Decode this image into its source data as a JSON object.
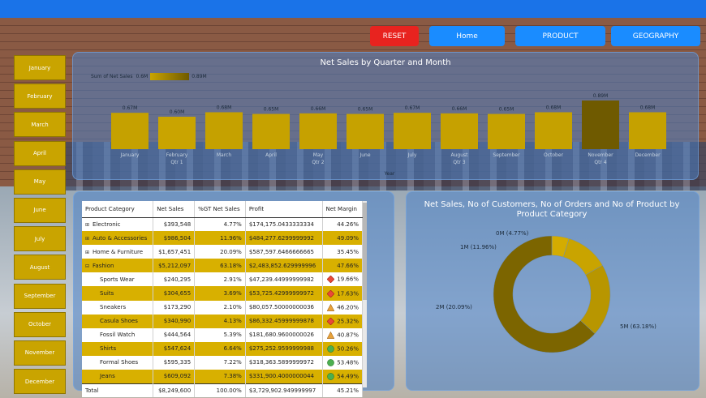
{
  "nav": {
    "reset": "RESET",
    "home": "Home",
    "product": "PRODUCT",
    "geography": "GEOGRAPHY"
  },
  "months": [
    "January",
    "February",
    "March",
    "April",
    "May",
    "June",
    "July",
    "August",
    "September",
    "October",
    "November",
    "December"
  ],
  "bar_chart": {
    "title": "Net Sales by Quarter and Month",
    "legend_label": "Sum of Net Sales",
    "legend_min": "0.6M",
    "legend_max": "0.89M",
    "xaxis_label": "Year",
    "categories": [
      "January",
      "February",
      "March",
      "April",
      "May",
      "June",
      "July",
      "August",
      "September",
      "October",
      "November",
      "December"
    ],
    "value_labels": [
      "0.67M",
      "0.60M",
      "0.68M",
      "0.65M",
      "0.66M",
      "0.65M",
      "0.67M",
      "0.66M",
      "0.65M",
      "0.68M",
      "0.89M",
      "0.68M"
    ],
    "values": [
      0.67,
      0.6,
      0.68,
      0.65,
      0.66,
      0.65,
      0.67,
      0.66,
      0.65,
      0.68,
      0.89,
      0.68
    ],
    "qtr_labels": [
      "Qtr 1",
      "Qtr 2",
      "Qtr 3",
      "Qtr 4"
    ],
    "colors": {
      "low": "#c9a400",
      "high": "#6f5a00"
    }
  },
  "table": {
    "headers": [
      "Product Category",
      "Net Sales",
      "%GT Net Sales",
      "Profit",
      "Net Margin"
    ],
    "rows": [
      {
        "cat": "Electronic",
        "sales": "$393,548",
        "pct": "4.77%",
        "profit": "$174,175.0433333334",
        "margin": "44.26%",
        "level": 0,
        "hl": false,
        "icon": ""
      },
      {
        "cat": "Auto & Accessories",
        "sales": "$986,504",
        "pct": "11.96%",
        "profit": "$484,277.6299999992",
        "margin": "49.09%",
        "level": 0,
        "hl": true,
        "icon": ""
      },
      {
        "cat": "Home & Furniture",
        "sales": "$1,657,451",
        "pct": "20.09%",
        "profit": "$587,597.6466666665",
        "margin": "35.45%",
        "level": 0,
        "hl": false,
        "icon": ""
      },
      {
        "cat": "Fashion",
        "sales": "$5,212,097",
        "pct": "63.18%",
        "profit": "$2,483,852.629999996",
        "margin": "47.66%",
        "level": 0,
        "hl": true,
        "icon": ""
      },
      {
        "cat": "Sports Wear",
        "sales": "$240,295",
        "pct": "2.91%",
        "profit": "$47,239.44999999982",
        "margin": "19.66%",
        "level": 1,
        "hl": false,
        "icon": "diamond"
      },
      {
        "cat": "Suits",
        "sales": "$304,655",
        "pct": "3.69%",
        "profit": "$53,725.42999999972",
        "margin": "17.63%",
        "level": 1,
        "hl": true,
        "icon": "diamond"
      },
      {
        "cat": "Sneakers",
        "sales": "$173,290",
        "pct": "2.10%",
        "profit": "$80,057.50000000036",
        "margin": "46.20%",
        "level": 1,
        "hl": false,
        "icon": "triangle"
      },
      {
        "cat": "Casula Shoes",
        "sales": "$340,990",
        "pct": "4.13%",
        "profit": "$86,332.45999999878",
        "margin": "25.32%",
        "level": 1,
        "hl": true,
        "icon": "diamond"
      },
      {
        "cat": "Fossil Watch",
        "sales": "$444,564",
        "pct": "5.39%",
        "profit": "$181,680.9600000026",
        "margin": "40.87%",
        "level": 1,
        "hl": false,
        "icon": "triangle"
      },
      {
        "cat": "Shirts",
        "sales": "$547,624",
        "pct": "6.64%",
        "profit": "$275,252.9599999988",
        "margin": "50.26%",
        "level": 1,
        "hl": true,
        "icon": "circle"
      },
      {
        "cat": "Formal Shoes",
        "sales": "$595,335",
        "pct": "7.22%",
        "profit": "$318,363.5899999972",
        "margin": "53.48%",
        "level": 1,
        "hl": false,
        "icon": "circle"
      },
      {
        "cat": "Jeans",
        "sales": "$609,092",
        "pct": "7.38%",
        "profit": "$331,900.4000000044",
        "margin": "54.49%",
        "level": 1,
        "hl": true,
        "icon": "circle"
      }
    ],
    "total": {
      "cat": "Total",
      "sales": "$8,249,600",
      "pct": "100.00%",
      "profit": "$3,729,902.949999997",
      "margin": "45.21%"
    }
  },
  "donut": {
    "title": "Net Sales, No of Customers, No of Orders and No of Product by Product Category",
    "slices": [
      {
        "label": "0M (4.77%)",
        "pct": 4.77,
        "color": "#d4ac00"
      },
      {
        "label": "1M (11.96%)",
        "pct": 11.96,
        "color": "#c9a400"
      },
      {
        "label": "2M (20.09%)",
        "pct": 20.09,
        "color": "#b89600"
      },
      {
        "label": "5M (63.18%)",
        "pct": 63.18,
        "color": "#7c6500"
      }
    ]
  }
}
